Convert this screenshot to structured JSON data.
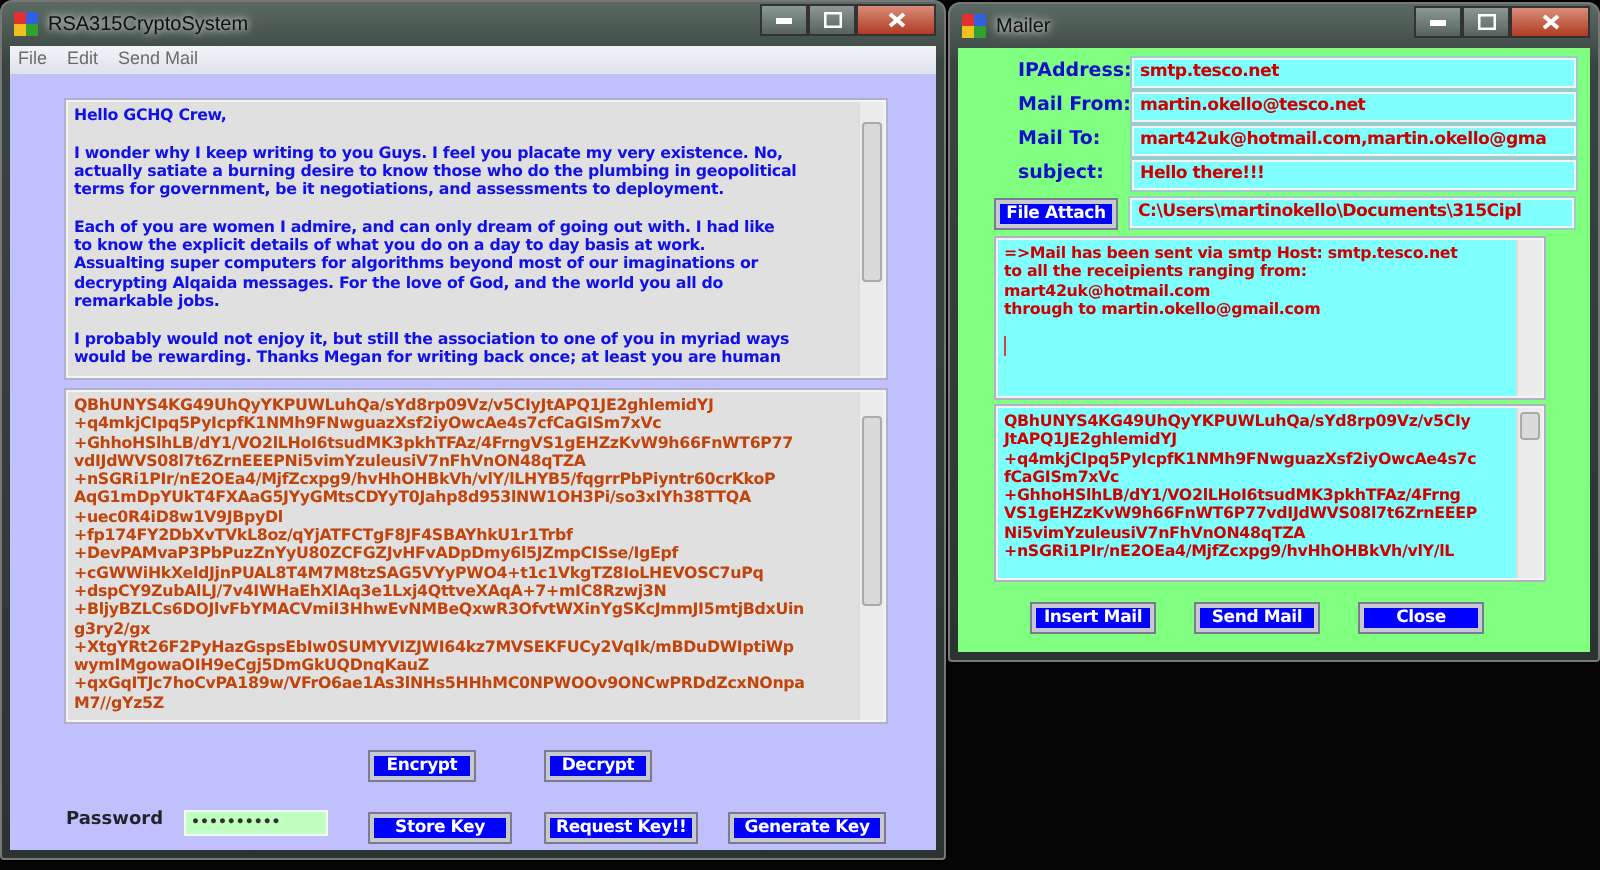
{
  "crypto_window": {
    "title": "RSA315CryptoSystem",
    "menu": [
      "File",
      "Edit",
      "Send Mail"
    ],
    "message_text": "Hello GCHQ Crew,\n\nI wonder why I keep writing to you Guys. I feel you placate my very existence. No,\nactually satiate a burning desire to know those who do the plumbing in geopolitical\nterms for government, be it negotiations, and assessments to deployment.\n\nEach of you are women I admire, and can only dream of going out with. I had like\nto know the explicit details of what you do on a day to day basis at work.\nAssualting super computers for algorithms beyond most of our imaginations or\ndecrypting Alqaida messages. For the love of God, and the world you all do\nremarkable jobs.\n\nI probably would not enjoy it, but still the association to one of you in myriad ways\nwould be rewarding. Thanks Megan for writing back once; at least you are human",
    "cipher_text": "QBhUNYS4KG49UhQyYKPUWLuhQa/sYd8rp09Vz/v5CIyJtAPQ1JE2ghlemidYJ\n+q4mkjCIpq5PyIcpfK1NMh9FNwguazXsf2iyOwcAe4s7cfCaGISm7xVc\n+GhhoHSlhLB/dY1/VO2lLHoI6tsudMK3pkhTFAz/4FrngVS1gEHZzKvW9h66FnWT6P77\nvdIJdWVS08l7t6ZrnEEEPNi5vimYzuleusiV7nFhVnON48qTZA\n+nSGRi1PIr/nE2OEa4/MjfZcxpg9/hvHhOHBkVh/vlY/lLHYB5/fqgrrPbPiyntr60crKkoP\nAqG1mDpYUkT4FXAaG5JYyGMtsCDYyT0Jahp8d953lNW1OH3Pi/so3xIYh38TTQA\n+uec0R4iD8w1V9JBpyDl\n+fp174FY2DbXvTVkL8oz/qYjATFCTgF8JF4SBAYhkU1r1Trbf\n+DevPAMvaP3PbPuzZnYyU80ZCFGZJvHFvADpDmy6l5JZmpCISse/IgEpf\n+cGWWiHkXeldJjnPUAL8T4M7M8tzSAG5VYyPWO4+t1c1VkgTZ8IoLHEVOSC7uPq\n+dspCY9ZubAlLJ/7v4IWHaEhXlAq3e1Lxj4QttveXAqA+7+mIC8Rzwj3N\n+BljyBZLCs6DOJlvFbYMACVmiI3HhwEvNMBeQxwR3OfvtWXinYgSKcJmmJI5mtjBdxUin\ng3ry2/gx\n+XtgYRt26F2PyHazGspsEbIw0SUMYVIZJWI64kz7MVSEKFUCy2VqIk/mBDuDWIptiWp\nwymIMgowaOIH9eCgj5DmGkUQDnqKauZ\n+qxGqITJc7hoCvPA189w/VFrO6ae1As3lNHs5HHhMC0NPWOOv9ONCwPRDdZcxNOnpa\nM7//gYz5Z",
    "crypt_buttons": [
      "Encrypt",
      "Decrypt"
    ],
    "password": {
      "label": "Password",
      "masked_value": "••••••••••"
    },
    "key_buttons": [
      "Store Key",
      "Request Key!!",
      "Generate Key"
    ]
  },
  "mailer_window": {
    "title": "Mailer",
    "fields": [
      {
        "label": "IPAddress:",
        "value": "smtp.tesco.net"
      },
      {
        "label": "Mail From:",
        "value": "martin.okello@tesco.net"
      },
      {
        "label": "Mail To:",
        "value": "mart42uk@hotmail.com,martin.okello@gma"
      },
      {
        "label": "subject:",
        "value": "Hello there!!!"
      }
    ],
    "attach_button": "File Attach",
    "attach_path": "C:\\Users\\martinokello\\Documents\\315Cipl",
    "status_text": "=>Mail has been sent via smtp Host: smtp.tesco.net\nto all the receipients ranging from:\nmart42uk@hotmail.com\nthrough to martin.okello@gmail.com",
    "body_text": "QBhUNYS4KG49UhQyYKPUWLuhQa/sYd8rp09Vz/v5CIy\nJtAPQ1JE2ghlemidYJ\n+q4mkjCIpq5PyIcpfK1NMh9FNwguazXsf2iyOwcAe4s7c\nfCaGISm7xVc\n+GhhoHSlhLB/dY1/VO2lLHoI6tsudMK3pkhTFAz/4Frng\nVS1gEHZzKvW9h66FnWT6P77vdIJdWVS08l7t6ZrnEEEP\nNi5vimYzuleusiV7nFhVnON48qTZA\n+nSGRi1PIr/nE2OEa4/MjfZcxpg9/hvHhOHBkVh/vlY/lL",
    "buttons": [
      "Insert Mail",
      "Send Mail",
      "Close"
    ]
  }
}
